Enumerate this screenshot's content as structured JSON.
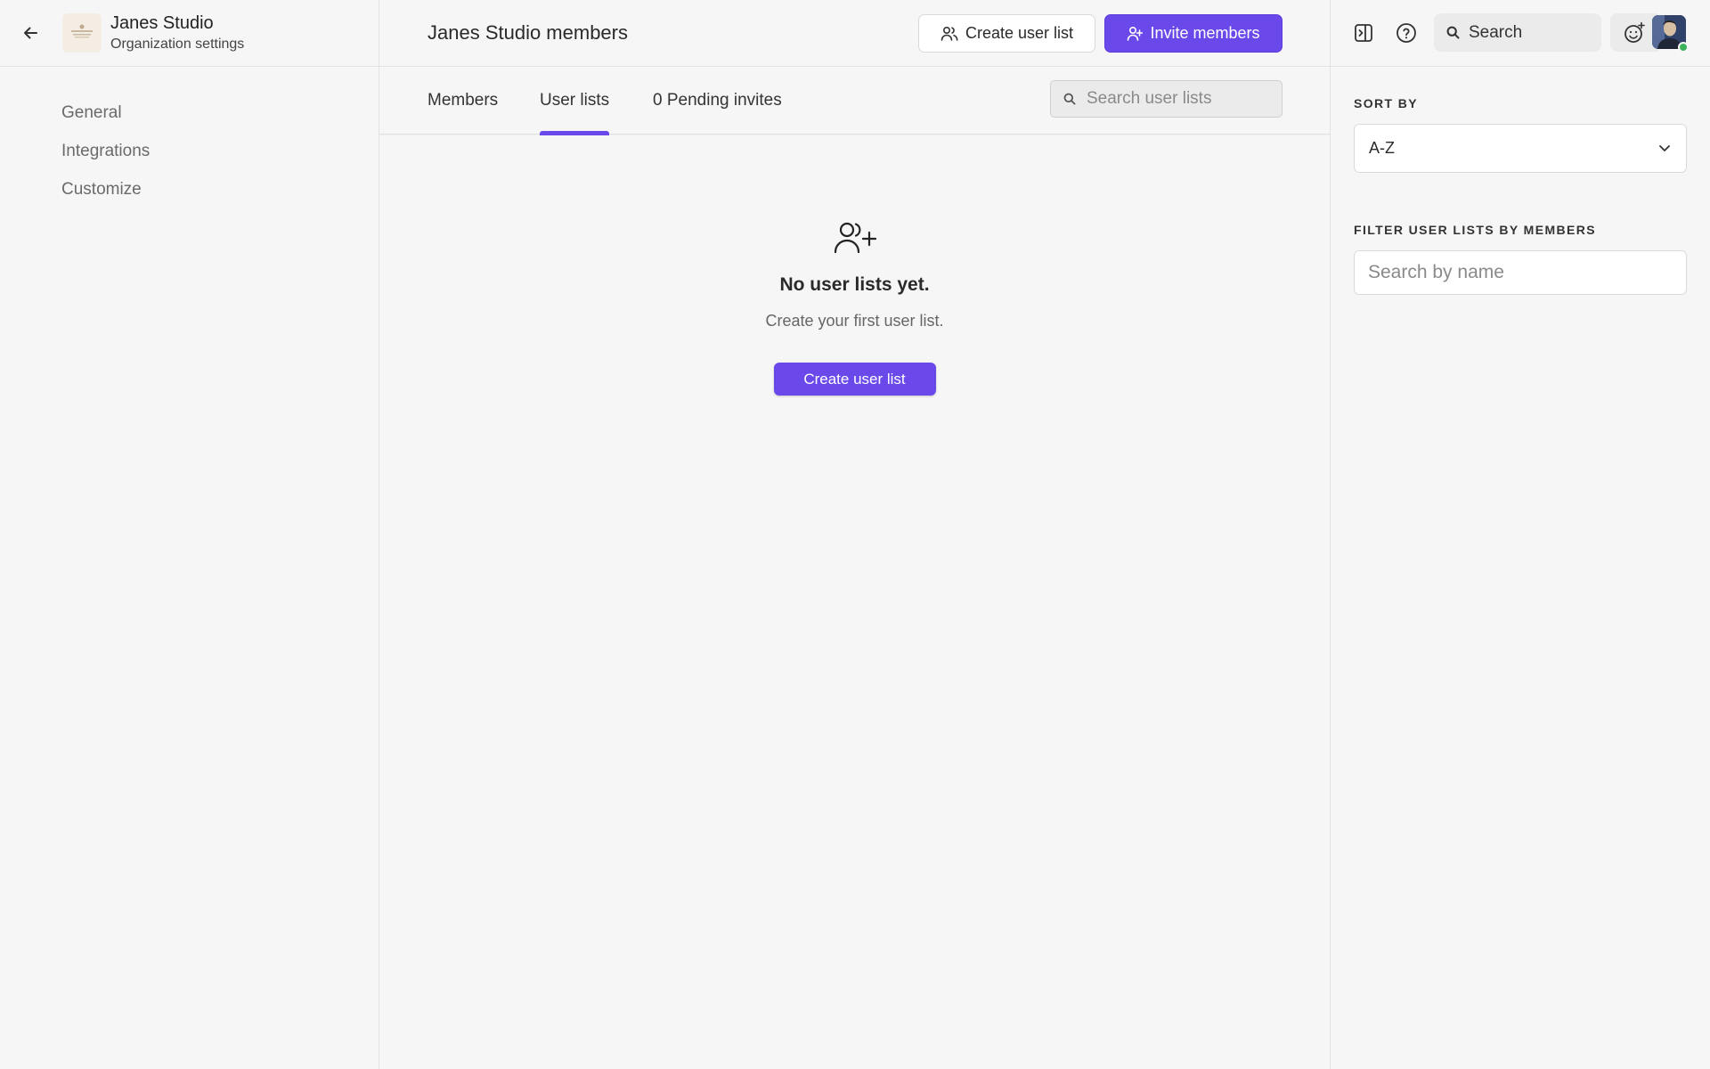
{
  "org": {
    "name": "Janes Studio",
    "subtitle": "Organization settings"
  },
  "nav": {
    "items": [
      {
        "label": "General"
      },
      {
        "label": "Integrations"
      },
      {
        "label": "Customize"
      }
    ]
  },
  "header": {
    "title": "Janes Studio members",
    "create_list_label": "Create user list",
    "invite_label": "Invite members"
  },
  "tabs": [
    {
      "label": "Members",
      "active": false
    },
    {
      "label": "User lists",
      "active": true
    },
    {
      "label": "0 Pending invites",
      "active": false
    }
  ],
  "list_search": {
    "placeholder": "Search user lists"
  },
  "empty_state": {
    "title": "No user lists yet.",
    "subtitle": "Create your first user list.",
    "button_label": "Create user list"
  },
  "topbar": {
    "search_label": "Search"
  },
  "sort": {
    "label": "SORT BY",
    "value": "A-Z"
  },
  "filter": {
    "label": "FILTER USER LISTS BY MEMBERS",
    "placeholder": "Search by name"
  },
  "colors": {
    "accent": "#6a48ea",
    "background": "#f6f6f6",
    "online": "#3cb35a"
  },
  "icons": [
    "arrow-left-icon",
    "users-icon",
    "user-plus-icon",
    "search-icon",
    "sidebar-toggle-icon",
    "help-icon",
    "emoji-add-icon",
    "chevron-down-icon"
  ]
}
